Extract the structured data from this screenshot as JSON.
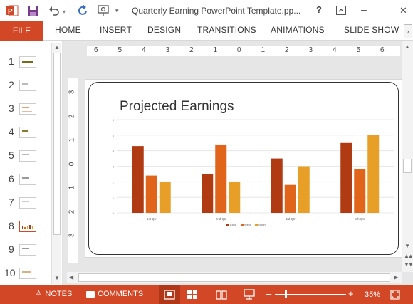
{
  "window": {
    "title": "Quarterly Earning PowerPoint Template.pp...",
    "help": "?",
    "minimize": "–",
    "close": "✕"
  },
  "ribbon": {
    "file": "FILE",
    "tabs": [
      "HOME",
      "INSERT",
      "DESIGN",
      "TRANSITIONS",
      "ANIMATIONS",
      "SLIDE SHOW"
    ]
  },
  "thumbnails": {
    "numbers": [
      "1",
      "2",
      "3",
      "4",
      "5",
      "6",
      "7",
      "8",
      "9",
      "10"
    ],
    "selected": "8"
  },
  "ruler": {
    "horizontal": [
      "6",
      "5",
      "4",
      "3",
      "2",
      "1",
      "0",
      "1",
      "2",
      "3",
      "4",
      "5",
      "6"
    ],
    "vertical": [
      "3",
      "2",
      "1",
      "0",
      "1",
      "2",
      "3"
    ]
  },
  "slide": {
    "title": "Projected Earnings"
  },
  "chart_data": {
    "type": "bar",
    "categories": [
      "1st Qtr",
      "2nd Qtr",
      "3rd Qtr",
      "4th Qtr"
    ],
    "series": [
      {
        "name": "East",
        "values": [
          4.3,
          2.5,
          3.5,
          4.5
        ]
      },
      {
        "name": "West",
        "values": [
          2.4,
          4.4,
          1.8,
          2.8
        ]
      },
      {
        "name": "North",
        "values": [
          2.0,
          2.0,
          3.0,
          5.0
        ]
      }
    ],
    "ylim": [
      0,
      6
    ],
    "yticks": [
      "0",
      "1",
      "2",
      "3",
      "4",
      "5",
      "6"
    ],
    "grid": true,
    "legend": "bottom",
    "colors": [
      "#b03b12",
      "#e06419",
      "#e79f27"
    ]
  },
  "status": {
    "notes": "NOTES",
    "comments": "COMMENTS",
    "zoom": "35%",
    "zoom_minus": "–",
    "zoom_plus": "+"
  },
  "colors": {
    "accent": "#d24726"
  }
}
